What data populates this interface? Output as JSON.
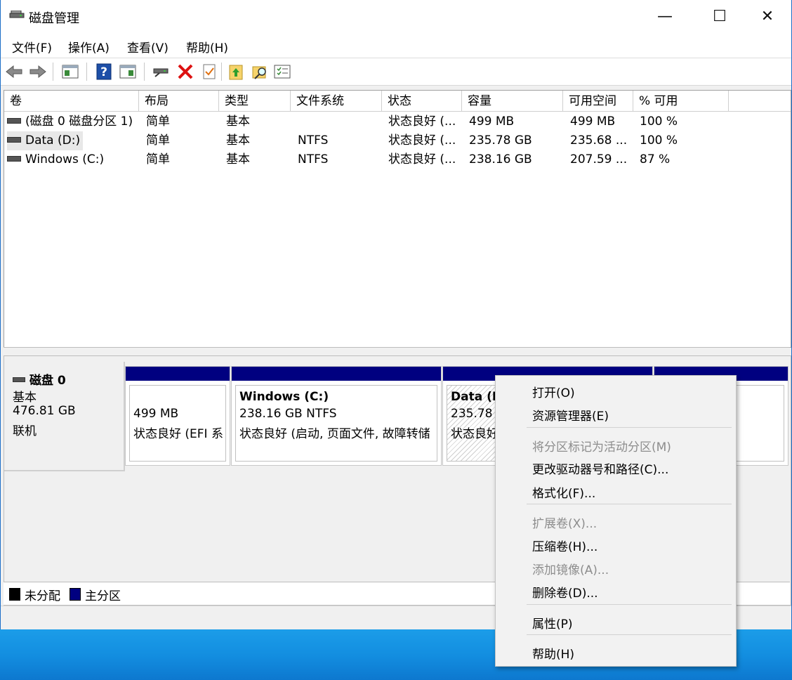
{
  "window": {
    "title": "磁盘管理",
    "minimize": "—",
    "maximize": "☐",
    "close": "✕"
  },
  "menu": [
    "文件(F)",
    "操作(A)",
    "查看(V)",
    "帮助(H)"
  ],
  "toolbar_icons": [
    "back-arrow-icon",
    "forward-arrow-icon",
    "console-tree-icon",
    "help-icon",
    "show-hide-icon",
    "connect-icon",
    "delete-icon",
    "properties-icon",
    "export-icon",
    "search-folder-icon",
    "list-icon"
  ],
  "volumes": {
    "columns": [
      "卷",
      "布局",
      "类型",
      "文件系统",
      "状态",
      "容量",
      "可用空间",
      "% 可用"
    ],
    "rows": [
      [
        "(磁盘 0 磁盘分区 1)",
        "简单",
        "基本",
        "",
        "状态良好 (...",
        "499 MB",
        "499 MB",
        "100 %"
      ],
      [
        "Data (D:)",
        "简单",
        "基本",
        "NTFS",
        "状态良好 (...",
        "235.78 GB",
        "235.68 ...",
        "100 %"
      ],
      [
        "Windows (C:)",
        "简单",
        "基本",
        "NTFS",
        "状态良好 (...",
        "238.16 GB",
        "207.59 ...",
        "87 %"
      ]
    ]
  },
  "disk": {
    "name": "磁盘 0",
    "type": "基本",
    "size": "476.81 GB",
    "status": "联机",
    "partitions": [
      {
        "title": "",
        "line1": "499 MB",
        "line2": "状态良好 (EFI 系"
      },
      {
        "title": "Windows  (C:)",
        "line1": "238.16 GB NTFS",
        "line2": "状态良好 (启动, 页面文件, 故障转储"
      },
      {
        "title": "Data  (I",
        "line1": "235.78 (",
        "line2": "状态良好"
      }
    ]
  },
  "legend": {
    "unallocated": "未分配",
    "primary": "主分区"
  },
  "colors": {
    "primary_partition": "#000080",
    "unallocated": "#000000"
  },
  "context_menu": [
    {
      "label": "打开(O)",
      "enabled": true
    },
    {
      "label": "资源管理器(E)",
      "enabled": true
    },
    {
      "label": "将分区标记为活动分区(M)",
      "enabled": false
    },
    {
      "label": "更改驱动器号和路径(C)...",
      "enabled": true
    },
    {
      "label": "格式化(F)...",
      "enabled": true
    },
    {
      "label": "扩展卷(X)...",
      "enabled": false
    },
    {
      "label": "压缩卷(H)...",
      "enabled": true
    },
    {
      "label": "添加镜像(A)...",
      "enabled": false
    },
    {
      "label": "删除卷(D)...",
      "enabled": true
    },
    {
      "label": "属性(P)",
      "enabled": true
    },
    {
      "label": "帮助(H)",
      "enabled": true
    }
  ]
}
